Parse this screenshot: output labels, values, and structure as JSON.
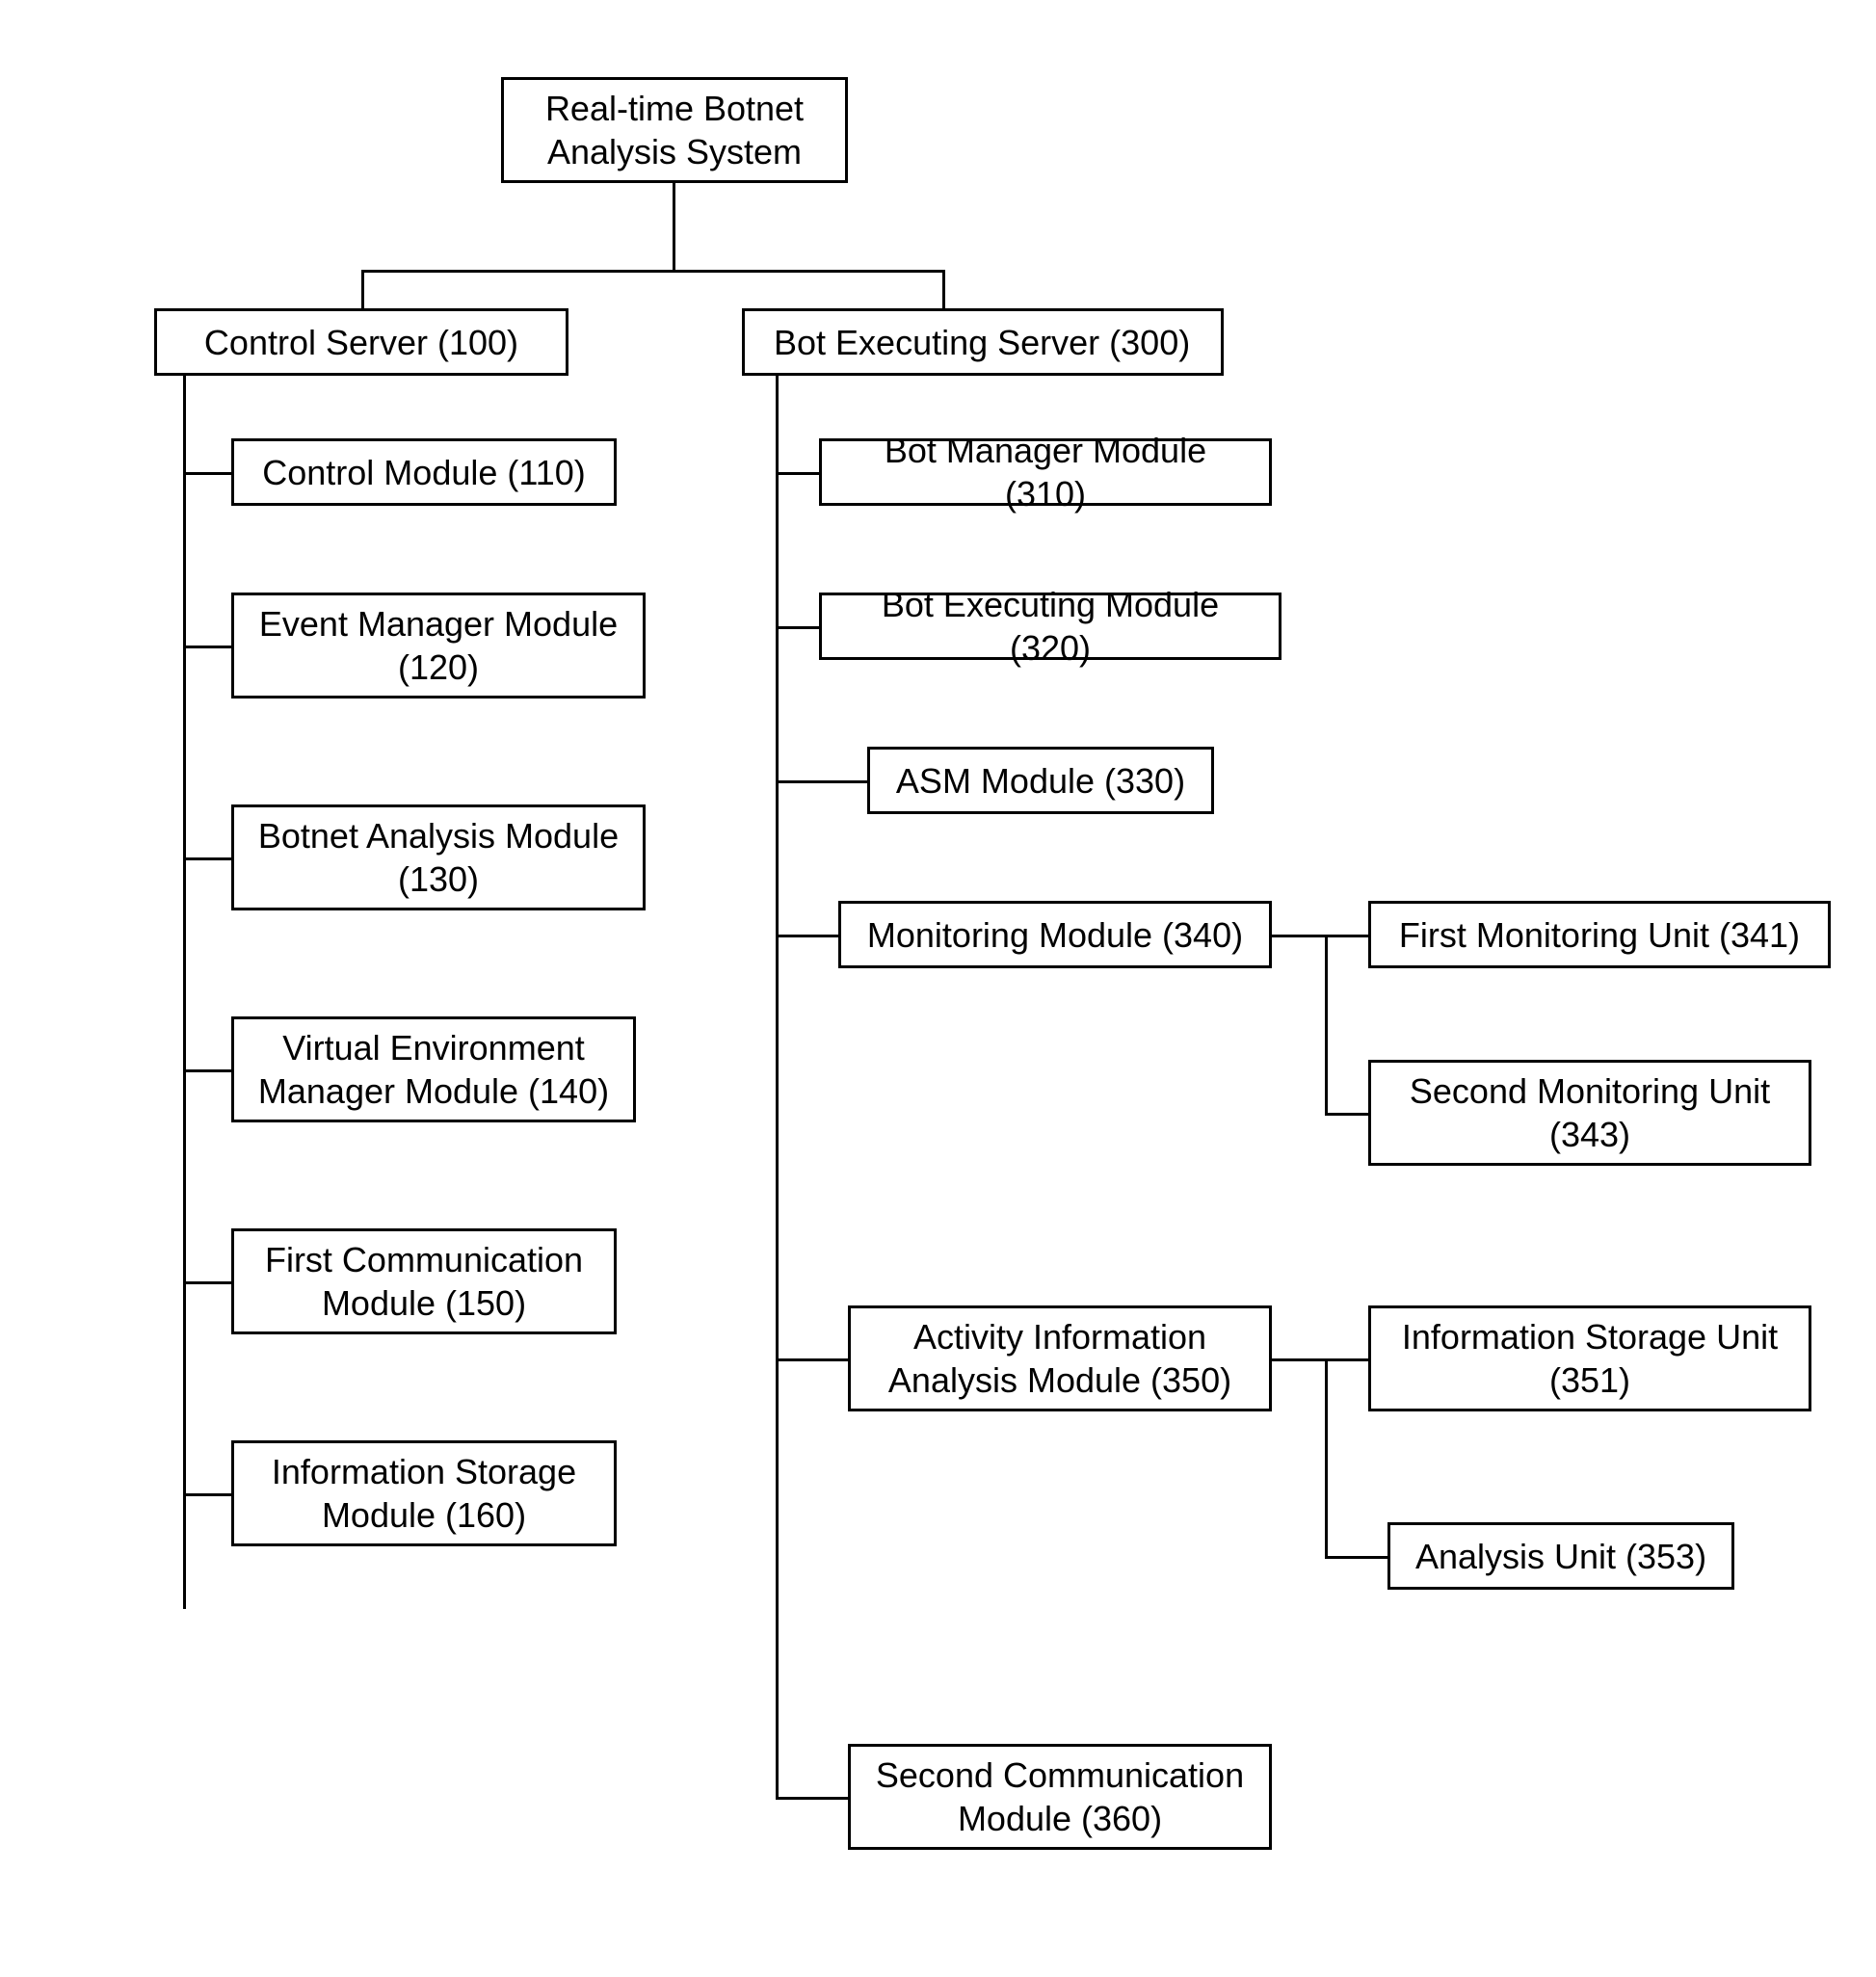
{
  "root": {
    "label": "Real-time Botnet Analysis System"
  },
  "control_server": {
    "label": "Control Server (100)",
    "children": {
      "c110": "Control Module (110)",
      "c120": "Event Manager Module (120)",
      "c130": "Botnet Analysis Module (130)",
      "c140": "Virtual Environment Manager Module (140)",
      "c150": "First Communication Module (150)",
      "c160": "Information Storage Module (160)"
    }
  },
  "bot_server": {
    "label": "Bot Executing Server (300)",
    "children": {
      "b310": "Bot Manager Module (310)",
      "b320": "Bot Executing Module (320)",
      "b330": "ASM Module (330)",
      "b340": {
        "label": "Monitoring Module (340)",
        "children": {
          "m341": "First Monitoring Unit (341)",
          "m343": "Second Monitoring Unit (343)"
        }
      },
      "b350": {
        "label": "Activity Information Analysis Module (350)",
        "children": {
          "a351": "Information Storage Unit (351)",
          "a353": "Analysis Unit (353)"
        }
      },
      "b360": "Second Communication Module (360)"
    }
  }
}
